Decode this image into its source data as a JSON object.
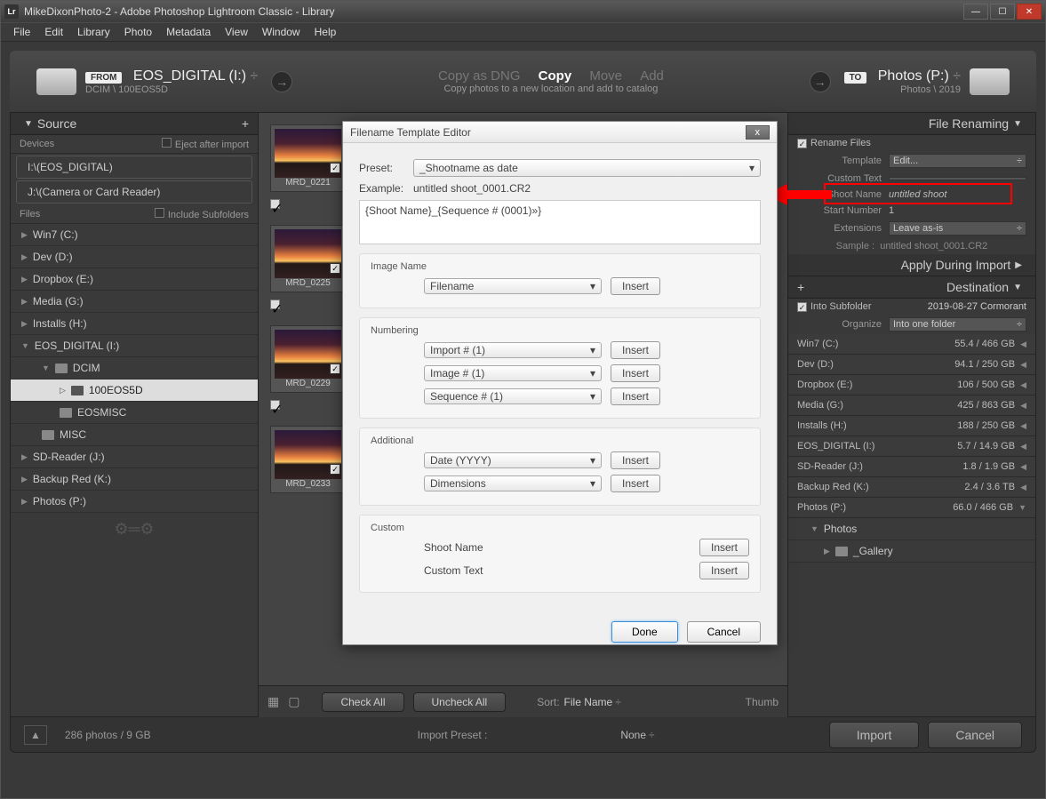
{
  "window": {
    "title": "MikeDixonPhoto-2 - Adobe Photoshop Lightroom Classic - Library",
    "app_icon": "Lr"
  },
  "menubar": [
    "File",
    "Edit",
    "Library",
    "Photo",
    "Metadata",
    "View",
    "Window",
    "Help"
  ],
  "import": {
    "from_pill": "FROM",
    "from_label": "EOS_DIGITAL (I:)",
    "from_sub": "DCIM \\ 100EOS5D",
    "modes": {
      "dng": "Copy as DNG",
      "copy": "Copy",
      "move": "Move",
      "add": "Add"
    },
    "mode_desc": "Copy photos to a new location and add to catalog",
    "to_pill": "TO",
    "to_label": "Photos (P:)",
    "to_sub": "Photos \\ 2019"
  },
  "source": {
    "title": "Source",
    "devices_label": "Devices",
    "eject_label": "Eject after import",
    "cardA": "I:\\(EOS_DIGITAL)",
    "cardB": "J:\\(Camera or Card Reader)",
    "files_label": "Files",
    "subfolders_label": "Include Subfolders",
    "drives": [
      "Win7 (C:)",
      "Dev (D:)",
      "Dropbox (E:)",
      "Media (G:)",
      "Installs (H:)"
    ],
    "eos": "EOS_DIGITAL (I:)",
    "dcim": "DCIM",
    "eos5d": "100EOS5D",
    "eosmisc": "EOSMISC",
    "misc": "MISC",
    "bottom": [
      "SD-Reader (J:)",
      "Backup Red (K:)",
      "Photos (P:)"
    ]
  },
  "thumbs": {
    "names": [
      "MRD_0221",
      "MRD_0225",
      "MRD_0229",
      "MRD_0233"
    ]
  },
  "thumbbar": {
    "check_all": "Check All",
    "uncheck_all": "Uncheck All",
    "sort_lbl": "Sort:",
    "sort_val": "File Name",
    "thumb_lbl": "Thumb"
  },
  "rightpanel": {
    "renaming_title": "File Renaming",
    "rename_chk": "Rename Files",
    "template_lbl": "Template",
    "template_val": "Edit...",
    "custom_lbl": "Custom Text",
    "custom_val": "",
    "shoot_lbl": "Shoot Name",
    "shoot_val": "untitled shoot",
    "start_lbl": "Start Number",
    "start_val": "1",
    "ext_lbl": "Extensions",
    "ext_val": "Leave as-is",
    "sample_lbl": "Sample :",
    "sample_val": "untitled shoot_0001.CR2",
    "apply_title": "Apply During Import",
    "dest_title": "Destination",
    "into_sub_lbl": "Into Subfolder",
    "into_sub_val": "2019-08-27 Cormorant",
    "org_lbl": "Organize",
    "org_val": "Into one folder",
    "dest_drives": [
      {
        "n": "Win7 (C:)",
        "s": "55.4 / 466 GB"
      },
      {
        "n": "Dev (D:)",
        "s": "94.1 / 250 GB"
      },
      {
        "n": "Dropbox (E:)",
        "s": "106 / 500 GB"
      },
      {
        "n": "Media (G:)",
        "s": "425 / 863 GB"
      },
      {
        "n": "Installs (H:)",
        "s": "188 / 250 GB"
      },
      {
        "n": "EOS_DIGITAL (I:)",
        "s": "5.7 / 14.9 GB"
      },
      {
        "n": "SD-Reader (J:)",
        "s": "1.8 / 1.9 GB"
      },
      {
        "n": "Backup Red (K:)",
        "s": "2.4 / 3.6 TB"
      },
      {
        "n": "Photos (P:)",
        "s": "66.0 / 466 GB"
      }
    ],
    "photos_folder": "Photos",
    "gallery_folder": "_Gallery"
  },
  "footer": {
    "count": "286 photos / 9 GB",
    "preset_lbl": "Import Preset :",
    "preset_val": "None",
    "import_btn": "Import",
    "cancel_btn": "Cancel"
  },
  "dialog": {
    "title": "Filename Template Editor",
    "preset_lbl": "Preset:",
    "preset_val": "_Shootname as date",
    "example_lbl": "Example:",
    "example_val": "untitled shoot_0001.CR2",
    "template_text": "{Shoot Name}_{Sequence # (0001)»}",
    "image_name": "Image Name",
    "filename": "Filename",
    "numbering": "Numbering",
    "num1": "Import # (1)",
    "num2": "Image # (1)",
    "num3": "Sequence # (1)",
    "additional": "Additional",
    "add1": "Date (YYYY)",
    "add2": "Dimensions",
    "custom": "Custom",
    "shoot_name": "Shoot Name",
    "custom_text": "Custom Text",
    "insert_btn": "Insert",
    "done_btn": "Done",
    "cancel_btn": "Cancel"
  }
}
